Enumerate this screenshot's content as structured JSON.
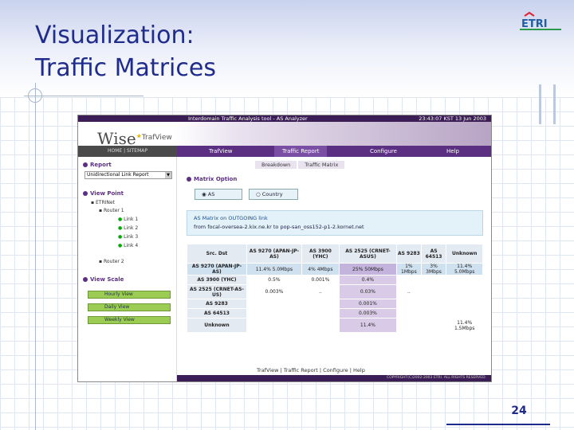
{
  "slide": {
    "title_line1": "Visualization:",
    "title_line2": "Traffic Matrices",
    "page_number": "24",
    "logo_text": "ETRI"
  },
  "app": {
    "header_left": "Interdomain Traffic Analysis tool - AS Analyzer",
    "header_right": "23:43:07 KST 13 Jun 2003",
    "brand": "Wise",
    "brand_suffix": "TrafView",
    "home_links": "HOME | SITEMAP",
    "nav": [
      "TrafView",
      "Traffic Report",
      "Configure",
      "Help"
    ],
    "subtabs": [
      "Breakdown",
      "Traffic Matrix"
    ],
    "sidebar": {
      "report_header": "Report",
      "report_select": "Unidirectional Link Report",
      "viewpoint_header": "View Point",
      "tree": [
        "ETRINet",
        "Router 1",
        "Link 1",
        "Link 2",
        "Link 3",
        "Link 4",
        "Router 2"
      ],
      "viewscale_header": "View Scale",
      "scale_buttons": [
        "Hourly View",
        "Daily View",
        "Weekly View"
      ]
    },
    "matrix_option_header": "Matrix Option",
    "options": [
      "AS",
      "Country"
    ],
    "info_title": "AS Matrix on OUTGOING link",
    "info_line": "from focal-oversea-2.kix.ne.kr to pop-san_oss152-p1-2.kornet.net",
    "matrix": {
      "header": [
        "Src. Dst",
        "AS 9270 (APAN-JP-AS)",
        "AS 3900 (YHC)",
        "AS 2525 (CRNET-ASUS)",
        "AS 9283",
        "AS 64513",
        "Unknown"
      ],
      "rows": [
        [
          "AS 9270 (APAN-JP-AS)",
          "11.4% 5.0Mbps",
          "4% 4Mbps",
          "25% 50Mbps",
          "1% 1Mbps",
          "3% 3Mbps",
          "11.4% 5.0Mbps"
        ],
        [
          "AS 3900 (YHC)",
          "0.5%",
          "0.001%",
          "0.4%",
          "",
          "",
          ""
        ],
        [
          "AS 2525 (CRNET-AS-US)",
          "0.003%",
          "..",
          "0.03%",
          "..",
          "",
          ""
        ],
        [
          "AS 9283",
          "",
          "",
          "0.001%",
          "",
          "",
          ""
        ],
        [
          "AS 64513",
          "",
          "",
          "0.003%",
          "",
          "",
          ""
        ],
        [
          "Unknown",
          "",
          "",
          "11.4%",
          "",
          "",
          "11.4% 1.5Mbps"
        ]
      ]
    },
    "footer_links": "TrafView | Traffic Report | Configure | Help",
    "copyright": "COPYRIGHT(C)2002-2003 ETRI. ALL RIGHTS RESERVED."
  },
  "colors": {
    "title": "#1f2c8c",
    "nav": "#5b2f82",
    "accent": "#3b1e55"
  }
}
